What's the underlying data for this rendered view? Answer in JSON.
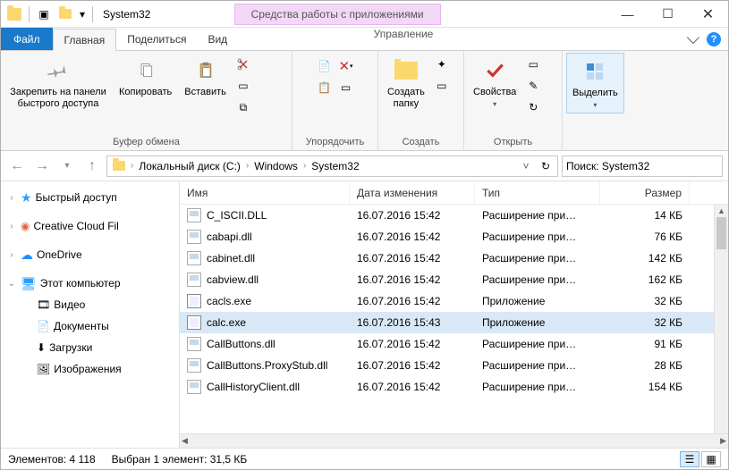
{
  "title": "System32",
  "context_tab": "Средства работы с приложениями",
  "menus": {
    "file": "Файл",
    "home": "Главная",
    "share": "Поделиться",
    "view": "Вид",
    "manage": "Управление"
  },
  "ribbon": {
    "pin": "Закрепить на панели\nбыстрого доступа",
    "copy": "Копировать",
    "paste": "Вставить",
    "clipboard_group": "Буфер обмена",
    "organize_group": "Упорядочить",
    "create_folder": "Создать\nпапку",
    "create_group": "Создать",
    "properties": "Свойства",
    "open_group": "Открыть",
    "select": "Выделить"
  },
  "breadcrumb": [
    "Локальный диск (C:)",
    "Windows",
    "System32"
  ],
  "search_placeholder": "Поиск: System32",
  "tree": {
    "quick": "Быстрый доступ",
    "creative": "Creative Cloud Fil",
    "onedrive": "OneDrive",
    "this_pc": "Этот компьютер",
    "videos": "Видео",
    "documents": "Документы",
    "downloads": "Загрузки",
    "images": "Изображения"
  },
  "columns": {
    "name": "Имя",
    "date": "Дата изменения",
    "type": "Тип",
    "size": "Размер"
  },
  "files": [
    {
      "name": "C_ISCII.DLL",
      "date": "16.07.2016 15:42",
      "type": "Расширение при…",
      "size": "14 КБ",
      "kind": "dll"
    },
    {
      "name": "cabapi.dll",
      "date": "16.07.2016 15:42",
      "type": "Расширение при…",
      "size": "76 КБ",
      "kind": "dll"
    },
    {
      "name": "cabinet.dll",
      "date": "16.07.2016 15:42",
      "type": "Расширение при…",
      "size": "142 КБ",
      "kind": "dll"
    },
    {
      "name": "cabview.dll",
      "date": "16.07.2016 15:42",
      "type": "Расширение при…",
      "size": "162 КБ",
      "kind": "dll"
    },
    {
      "name": "cacls.exe",
      "date": "16.07.2016 15:42",
      "type": "Приложение",
      "size": "32 КБ",
      "kind": "exe"
    },
    {
      "name": "calc.exe",
      "date": "16.07.2016 15:43",
      "type": "Приложение",
      "size": "32 КБ",
      "kind": "exe",
      "selected": true
    },
    {
      "name": "CallButtons.dll",
      "date": "16.07.2016 15:42",
      "type": "Расширение при…",
      "size": "91 КБ",
      "kind": "dll"
    },
    {
      "name": "CallButtons.ProxyStub.dll",
      "date": "16.07.2016 15:42",
      "type": "Расширение при…",
      "size": "28 КБ",
      "kind": "dll"
    },
    {
      "name": "CallHistoryClient.dll",
      "date": "16.07.2016 15:42",
      "type": "Расширение при…",
      "size": "154 КБ",
      "kind": "dll"
    }
  ],
  "status": {
    "items": "Элементов: 4 118",
    "selected": "Выбран 1 элемент: 31,5 КБ"
  }
}
